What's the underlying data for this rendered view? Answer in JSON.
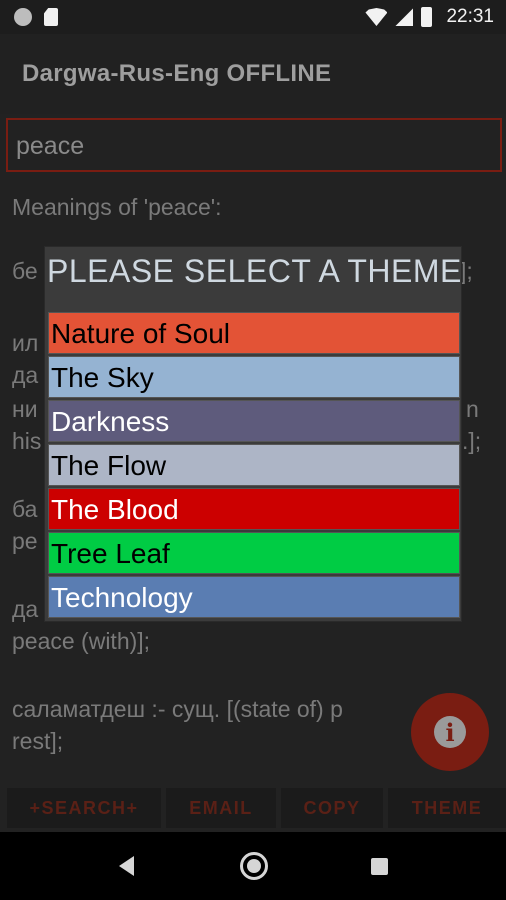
{
  "status_bar": {
    "time": "22:31",
    "icons": [
      "record-icon",
      "sd-card-icon",
      "wifi-icon",
      "cell-signal-icon",
      "battery-icon"
    ]
  },
  "app_bar": {
    "title": "Dargwa-Rus-Eng OFFLINE"
  },
  "search": {
    "value": "peace"
  },
  "results": [
    "Meanings of 'peace':",
    "бе",
    "ил",
    "да",
    "ни",
    "his",
    "ба",
    "pe",
    "да",
    "peace (with)];",
    "саламатдеш :- сущ. [(state of) p",
    "rest];"
  ],
  "results_right": [
    "];",
    "n",
    ".];"
  ],
  "dialog": {
    "title": "PLEASE SELECT A THEME",
    "options": [
      {
        "label": "Nature of Soul",
        "color": "#e35336",
        "text_color": "#000000"
      },
      {
        "label": "The Sky",
        "color": "#95b3d2",
        "text_color": "#000000"
      },
      {
        "label": "Darkness",
        "color": "#5e5b7c",
        "text_color": "#ffffff"
      },
      {
        "label": "The Flow",
        "color": "#adb5c6",
        "text_color": "#000000"
      },
      {
        "label": "The Blood",
        "color": "#cc0000",
        "text_color": "#ffffff"
      },
      {
        "label": "Tree Leaf",
        "color": "#00cc44",
        "text_color": "#000000"
      },
      {
        "label": "Technology",
        "color": "#5a7db2",
        "text_color": "#ffffff"
      }
    ]
  },
  "bottom_buttons": {
    "search": "+SEARCH+",
    "email": "EMAIL",
    "copy": "COPY",
    "theme": "THEME"
  },
  "fab": {
    "icon": "info-icon",
    "glyph": "i"
  },
  "nav": {
    "icons": [
      "back-icon",
      "home-icon",
      "recents-icon"
    ]
  }
}
